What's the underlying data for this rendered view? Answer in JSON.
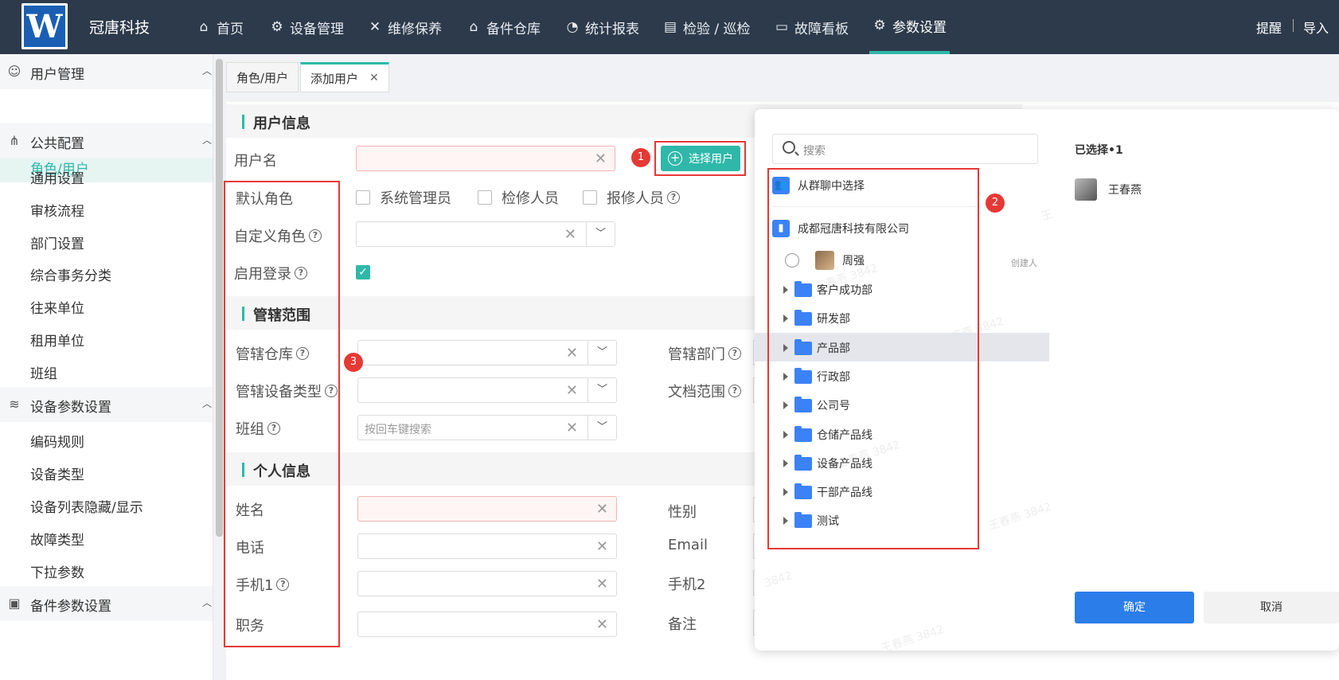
{
  "header": {
    "logo_letter": "W",
    "brand": "冠唐科技",
    "nav": [
      "首页",
      "设备管理",
      "维修保养",
      "备件仓库",
      "统计报表",
      "检验 / 巡检",
      "故障看板",
      "参数设置"
    ],
    "right": [
      "提醒",
      "导入"
    ]
  },
  "sidebar": {
    "g1": "用户管理",
    "g1_item": "角色/用户",
    "g2": "公共配置",
    "g2_items": [
      "通用设置",
      "审核流程",
      "部门设置",
      "综合事务分类",
      "往来单位",
      "租用单位",
      "班组"
    ],
    "g3": "设备参数设置",
    "g3_items": [
      "编码规则",
      "设备类型",
      "设备列表隐藏/显示",
      "故障类型",
      "下拉参数"
    ],
    "g4": "备件参数设置"
  },
  "tabs": [
    "角色/用户",
    "添加用户"
  ],
  "sections": {
    "user": "用户信息",
    "scope": "管辖范围",
    "personal": "个人信息"
  },
  "labels": {
    "username": "用户名",
    "default_role": "默认角色",
    "custom_role": "自定义角色",
    "enable_login": "启用登录",
    "warehouse": "管辖仓库",
    "dept": "管辖部门",
    "equip_type": "管辖设备类型",
    "doc_scope": "文档范围",
    "team": "班组",
    "name": "姓名",
    "gender": "性别",
    "phone": "电话",
    "email": "Email",
    "mobile1": "手机1",
    "mobile2": "手机2",
    "title": "职务",
    "remark": "备注"
  },
  "roles": [
    "系统管理员",
    "检修人员",
    "报修人员"
  ],
  "team_placeholder": "按回车键搜索",
  "select_user_btn": "选择用户",
  "badges": [
    "1",
    "2",
    "3"
  ],
  "dialog": {
    "search_placeholder": "搜索",
    "from_group": "从群聊中选择",
    "company": "成都冠唐科技有限公司",
    "member": "周强",
    "creator": "创建人",
    "folders": [
      "客户成功部",
      "研发部",
      "产品部",
      "行政部",
      "公司号",
      "仓储产品线",
      "设备产品线",
      "干部产品线",
      "测试"
    ],
    "selected_title": "已选择•1",
    "selected_user": "王春燕",
    "ok": "确定",
    "cancel": "取消",
    "watermarks": [
      "王春燕 3842",
      "王春燕 3842",
      "王春燕 3842",
      "王春燕 3842",
      "王春燕 3842",
      "3842",
      "王"
    ]
  },
  "colors": {
    "header_bg": "#2d3a4b",
    "accent": "#2fb8a9",
    "primary": "#2b7de9",
    "alert": "#e53935"
  }
}
